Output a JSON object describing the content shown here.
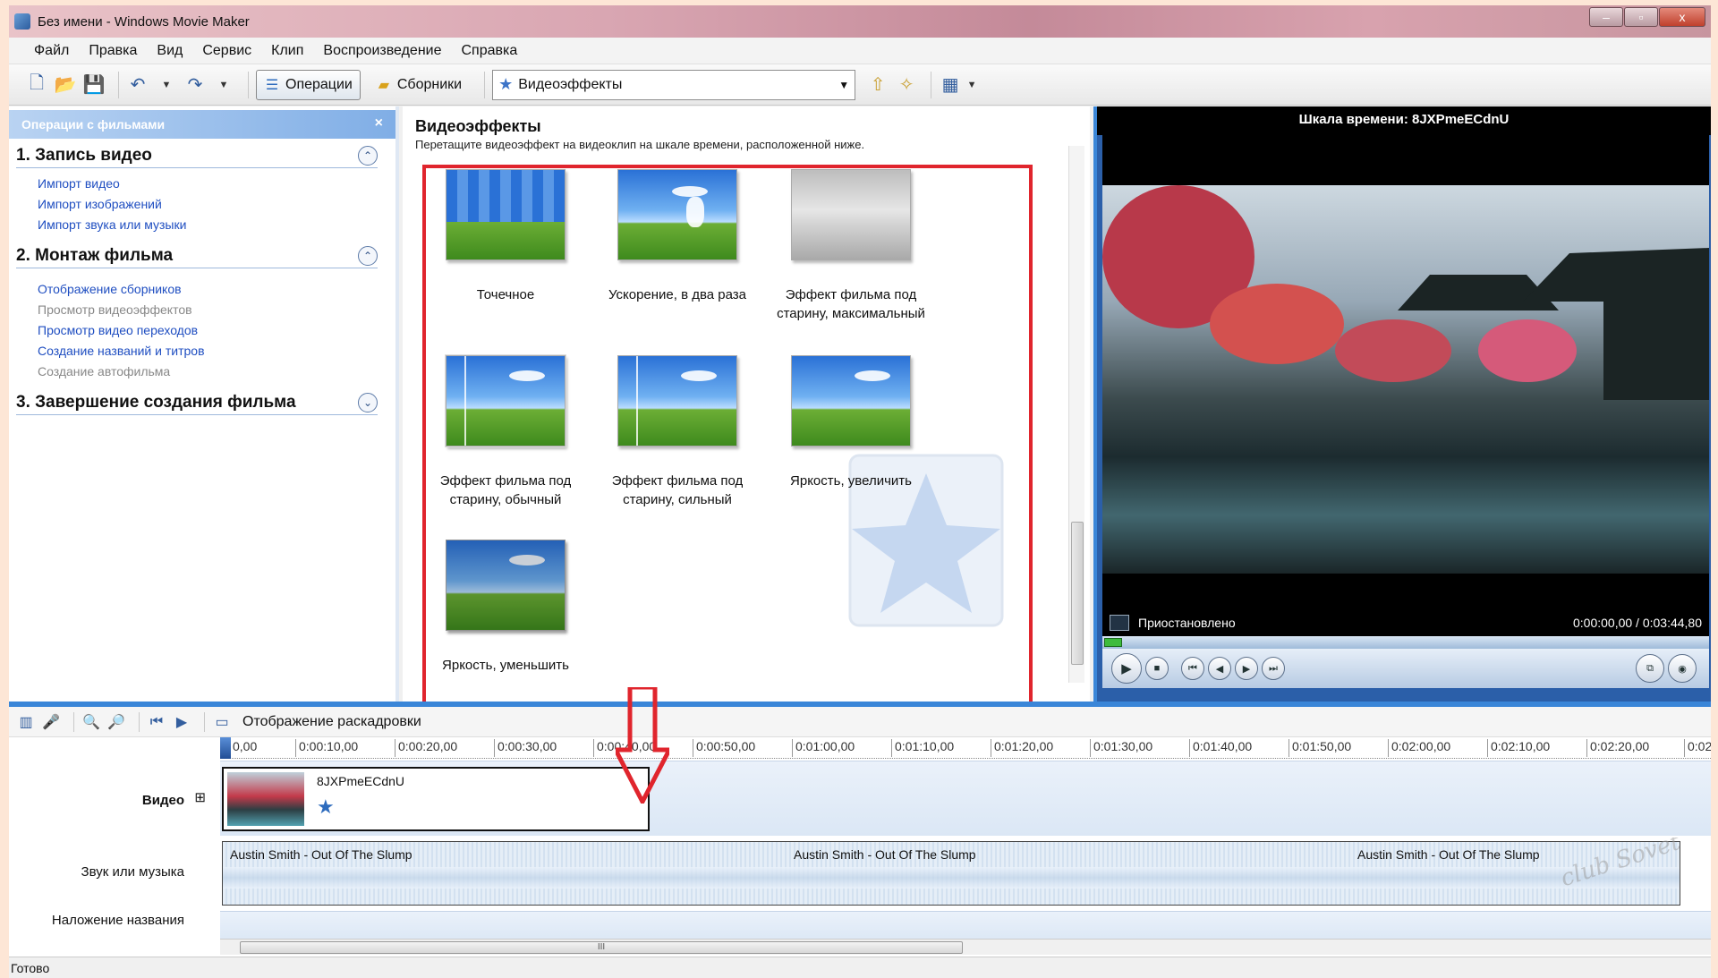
{
  "window": {
    "title": "Без имени - Windows Movie Maker",
    "min": "–",
    "max": "▫",
    "close": "x"
  },
  "menu": [
    "Файл",
    "Правка",
    "Вид",
    "Сервис",
    "Клип",
    "Воспроизведение",
    "Справка"
  ],
  "toolbar": {
    "operations": "Операции",
    "collections": "Сборники",
    "dropdown_value": "Видеоэффекты"
  },
  "tasks": {
    "header": "Операции с фильмами",
    "close": "×",
    "sections": [
      {
        "title": "1. Запись видео",
        "toggle": "⌃",
        "links": [
          {
            "label": "Импорт видео",
            "enabled": true
          },
          {
            "label": "Импорт изображений",
            "enabled": true
          },
          {
            "label": "Импорт звука или музыки",
            "enabled": true
          }
        ]
      },
      {
        "title": "2. Монтаж фильма",
        "toggle": "⌃",
        "links": [
          {
            "label": "Отображение сборников",
            "enabled": true
          },
          {
            "label": "Просмотр видеоэффектов",
            "enabled": false
          },
          {
            "label": "Просмотр видео переходов",
            "enabled": true
          },
          {
            "label": "Создание названий и титров",
            "enabled": true
          },
          {
            "label": "Создание автофильма",
            "enabled": false
          }
        ]
      },
      {
        "title": "3. Завершение создания фильма",
        "toggle": "⌄",
        "links": []
      }
    ]
  },
  "effects": {
    "title": "Видеоэффекты",
    "subtitle": "Перетащите видеоэффект на видеоклип на шкале времени, расположенной ниже.",
    "items": [
      {
        "label": "Точечное",
        "style": "pix"
      },
      {
        "label": "Ускорение, в два раза",
        "style": "sky"
      },
      {
        "label": "Эффект фильма под старину, максимальный",
        "style": "old"
      },
      {
        "label": "Эффект фильма под старину, обычный",
        "style": "oldv"
      },
      {
        "label": "Эффект фильма под старину, сильный",
        "style": "oldv"
      },
      {
        "label": "Яркость, увеличить",
        "style": "sky"
      },
      {
        "label": "Яркость, уменьшить",
        "style": "sky"
      }
    ]
  },
  "preview": {
    "title": "Шкала времени: 8JXPmeECdnU",
    "status": "Приостановлено",
    "time": "0:00:00,00 / 0:03:44,80"
  },
  "timeline": {
    "storyboard_label": "Отображение раскадровки",
    "ticks": [
      "0,00",
      "0:00:10,00",
      "0:00:20,00",
      "0:00:30,00",
      "0:00:40,00",
      "0:00:50,00",
      "0:01:00,00",
      "0:01:10,00",
      "0:01:20,00",
      "0:01:30,00",
      "0:01:40,00",
      "0:01:50,00",
      "0:02:00,00",
      "0:02:10,00",
      "0:02:20,00",
      "0:02"
    ],
    "tracks": {
      "video": "Видео",
      "video_expand": "⊞",
      "audio": "Звук или музыка",
      "title_overlay": "Наложение названия"
    },
    "clip_name": "8JXPmeECdnU",
    "audio_clips": [
      "Austin Smith - Out Of The Slump",
      "Austin Smith - Out Of The Slump",
      "Austin Smith - Out Of The Slump"
    ],
    "scroll_grip": "III"
  },
  "status": "Готово",
  "watermark": "club Sovet"
}
